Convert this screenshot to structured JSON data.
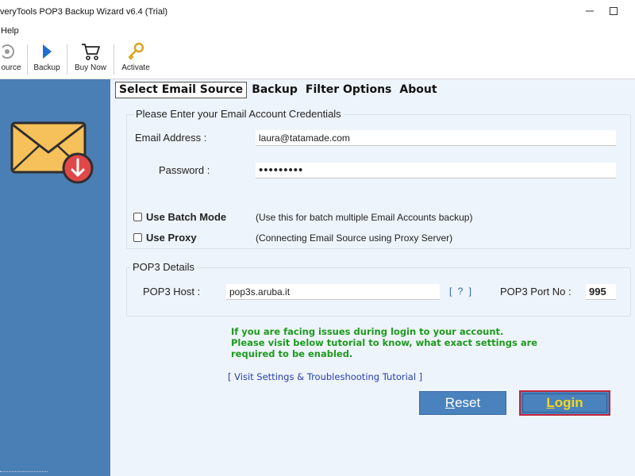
{
  "window": {
    "title": "veryTools POP3 Backup Wizard v6.4 (Trial)",
    "minimize_glyph": "—",
    "maximize_glyph": "☐"
  },
  "menu": {
    "items": [
      {
        "label": "Help"
      }
    ]
  },
  "toolbar": {
    "items": [
      {
        "label": "ource",
        "icon": "source-icon"
      },
      {
        "label": "Backup",
        "icon": "play-icon"
      },
      {
        "label": "Buy Now",
        "icon": "cart-icon"
      },
      {
        "label": "Activate",
        "icon": "key-icon"
      }
    ]
  },
  "sidebar": {
    "icon": "email-download-icon"
  },
  "tabs": [
    {
      "label": "Select Email Source",
      "active": true
    },
    {
      "label": "Backup",
      "active": false
    },
    {
      "label": "Filter Options",
      "active": false
    },
    {
      "label": "About",
      "active": false
    }
  ],
  "credentials": {
    "title": "Please Enter your Email Account Credentials",
    "email_label": "Email Address :",
    "email_value": "laura@tatamade.com",
    "password_label": "Password :",
    "password_value": "•••••••••",
    "batch_mode": {
      "label": "Use Batch Mode",
      "checked": false,
      "hint": "(Use this for batch multiple Email Accounts backup)"
    },
    "proxy": {
      "label": "Use Proxy",
      "checked": false,
      "hint": "(Connecting Email Source using Proxy Server)"
    }
  },
  "pop3": {
    "title": "POP3 Details",
    "host_label": "POP3 Host :",
    "host_value": "pop3s.aruba.it",
    "help_link": "[ ? ]",
    "port_label": "POP3 Port No :",
    "port_value": "995"
  },
  "notice": {
    "line1": "If you are facing issues during login to your account.",
    "line2": "Please visit below tutorial to know, what exact settings are",
    "line3": "required to be enabled."
  },
  "tutorial_link": "[ Visit Settings & Troubleshooting Tutorial ]",
  "buttons": {
    "reset_first": "R",
    "reset_rest": "eset",
    "login_first": "L",
    "login_rest": "ogin"
  },
  "colors": {
    "sidebar": "#4a7fb6",
    "content_bg": "#eef4fb",
    "notice_green": "#1d9a1d",
    "link_blue": "#2a3fb0",
    "button_blue": "#4a82bd",
    "login_text": "#f4d81c",
    "login_border": "#c4263a"
  }
}
